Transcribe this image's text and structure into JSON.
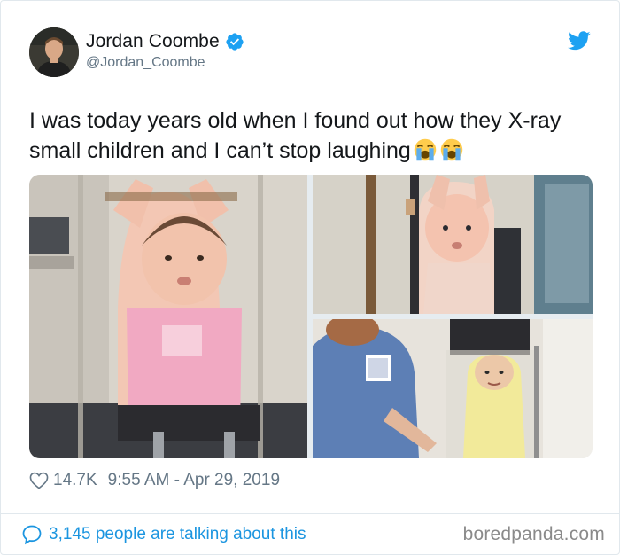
{
  "tweet": {
    "author": {
      "display_name": "Jordan Coombe",
      "handle": "@Jordan_Coombe",
      "verified": true,
      "avatar_icon": "profile-photo"
    },
    "text": "I was today years old when I found out how they X-ray small children and I can’t stop laughing",
    "emojis": [
      "loudly-crying-face-icon",
      "loudly-crying-face-icon"
    ],
    "media": [
      {
        "name": "baby-in-xray-tube-photo-1"
      },
      {
        "name": "baby-in-xray-tube-photo-2"
      },
      {
        "name": "baby-in-xray-tube-photo-3"
      }
    ],
    "likes": "14.7K",
    "timestamp": "9:55 AM - Apr 29, 2019"
  },
  "footer": {
    "talking": "3,145 people are talking about this",
    "watermark": "boredpanda.com"
  },
  "colors": {
    "twitter_blue": "#1da1f2",
    "link_blue": "#1b95e0",
    "text": "#14171a",
    "muted": "#657786",
    "border": "#e1e8ed"
  }
}
